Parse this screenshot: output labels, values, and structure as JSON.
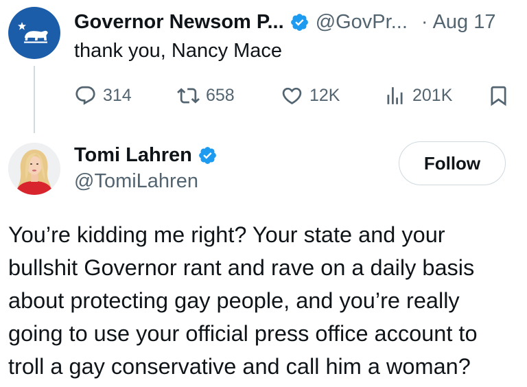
{
  "tweet1": {
    "author_name": "Governor Newsom P...",
    "handle": "@GovPr...",
    "separator": "·",
    "date": "Aug 17",
    "text": "thank you, Nancy Mace",
    "actions": {
      "replies": "314",
      "retweets": "658",
      "likes": "12K",
      "views": "201K"
    },
    "icons": {
      "avatar": "california-bear-flag-icon",
      "verified": "verified-badge-icon",
      "reply": "reply-icon",
      "retweet": "retweet-icon",
      "like": "heart-icon",
      "views": "views-icon",
      "bookmark": "bookmark-icon"
    }
  },
  "tweet2": {
    "author_name": "Tomi Lahren",
    "handle": "@TomiLahren",
    "follow_label": "Follow",
    "text": "You’re kidding me right? Your state and your\nbullshit Governor rant and rave on a daily basis\nabout protecting gay people, and you’re really\ngoing to use your official press office account to\ntroll a gay conservative and call him a woman?"
  },
  "colors": {
    "text_primary": "#0f1419",
    "text_secondary": "#536471",
    "verified_blue": "#1d9bf0",
    "avatar_blue": "#1c5da9",
    "border": "#cfd9de"
  }
}
